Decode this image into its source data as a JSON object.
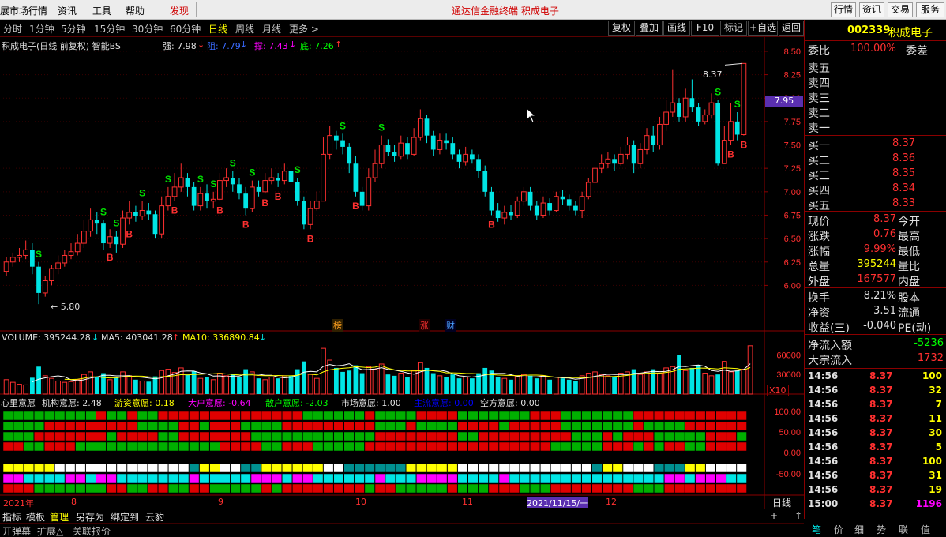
{
  "menu": {
    "items": [
      "展市场行情",
      "资讯",
      "工具",
      "帮助"
    ],
    "discover": "发现",
    "center_title": "通达信金融终端   积成电子",
    "right_buttons": [
      "行情",
      "资讯",
      "交易",
      "服务"
    ]
  },
  "toolbar": {
    "periods": [
      "分时",
      "1分钟",
      "5分钟",
      "15分钟",
      "30分钟",
      "60分钟",
      "日线",
      "周线",
      "月线",
      "更多 >"
    ],
    "active_period": "日线",
    "buttons": [
      "复权",
      "叠加",
      "画线",
      "F10",
      "标记",
      "+自选",
      "返回"
    ]
  },
  "chart_info": {
    "title": "积成电子(日线 前复权) 智能BS",
    "qiang": "强: 7.98",
    "zu": "阻: 7.79",
    "cheng": "撑: 7.43",
    "di": "底: 7.26",
    "current_price_tag": "7.95",
    "high_label": "8.37",
    "low_label": "5.80",
    "event_tags": [
      "榜",
      "涨",
      "财"
    ]
  },
  "volume_info": {
    "volume": "VOLUME: 395244.28",
    "ma5": "MA5: 403041.28",
    "ma10": "MA10: 336890.84",
    "x10": "X10"
  },
  "indicator_info": {
    "items": [
      {
        "label": "心里意愿",
        "color": "#e0e0e0"
      },
      {
        "label": "机构意愿: 2.48",
        "color": "#e0e0e0"
      },
      {
        "label": "游资意愿: 0.18",
        "color": "#ffff00"
      },
      {
        "label": "大户意愿: -0.64",
        "color": "#ff00ff"
      },
      {
        "label": "散户意愿: -2.03",
        "color": "#00ff00"
      },
      {
        "label": "市场意愿: 1.00",
        "color": "#e0e0e0"
      },
      {
        "label": "主流意愿: 0.00",
        "color": "#0000ff"
      },
      {
        "label": "空方意愿: 0.00",
        "color": "#e0e0e0"
      }
    ]
  },
  "date_axis": {
    "year": "2021年",
    "months": [
      "8",
      "9",
      "10",
      "11",
      "12"
    ],
    "cursor_date": "2021/11/15/一",
    "tab": "日线",
    "controls": [
      "+",
      "-",
      "↑"
    ]
  },
  "bottom_tabs": [
    "指标",
    "模板",
    "管理",
    "另存为",
    "绑定到",
    "云豹"
  ],
  "bottom_active": "管理",
  "bottom_bar": [
    "开弹幕",
    "扩展△",
    "关联报价"
  ],
  "right_panel": {
    "code": "002339",
    "name": "积成电子",
    "weibi_label": "委比",
    "weibi_value": "100.00%",
    "weicha_label": "委差",
    "sell": [
      "卖五",
      "卖四",
      "卖三",
      "卖二",
      "卖一"
    ],
    "buy": [
      {
        "label": "买一",
        "price": "8.37"
      },
      {
        "label": "买二",
        "price": "8.36"
      },
      {
        "label": "买三",
        "price": "8.35"
      },
      {
        "label": "买四",
        "price": "8.34"
      },
      {
        "label": "买五",
        "price": "8.33"
      }
    ],
    "stats": [
      {
        "l1": "现价",
        "v": "8.37",
        "c": "#ff3030",
        "l2": "今开"
      },
      {
        "l1": "涨跌",
        "v": "0.76",
        "c": "#ff3030",
        "l2": "最高"
      },
      {
        "l1": "涨幅",
        "v": "9.99%",
        "c": "#ff3030",
        "l2": "最低"
      },
      {
        "l1": "总量",
        "v": "395244",
        "c": "#ffff00",
        "l2": "量比"
      },
      {
        "l1": "外盘",
        "v": "167577",
        "c": "#ff3030",
        "l2": "内盘"
      }
    ],
    "stats2": [
      {
        "l1": "换手",
        "v": "8.21%",
        "c": "#e0e0e0",
        "l2": "股本"
      },
      {
        "l1": "净资",
        "v": "3.51",
        "c": "#e0e0e0",
        "l2": "流通"
      },
      {
        "l1": "收益(三)",
        "v": "-0.040",
        "c": "#e0e0e0",
        "l2": "PE(动)"
      }
    ],
    "net_inflow_label": "净流入额",
    "net_inflow_value": "-5236",
    "block_inflow_label": "大宗流入",
    "block_inflow_value": "1732",
    "ticks": [
      {
        "t": "14:56",
        "p": "8.37",
        "v": "100"
      },
      {
        "t": "14:56",
        "p": "8.37",
        "v": "32"
      },
      {
        "t": "14:56",
        "p": "8.37",
        "v": "7"
      },
      {
        "t": "14:56",
        "p": "8.37",
        "v": "11"
      },
      {
        "t": "14:56",
        "p": "8.37",
        "v": "30"
      },
      {
        "t": "14:56",
        "p": "8.37",
        "v": "5"
      },
      {
        "t": "14:56",
        "p": "8.37",
        "v": "100"
      },
      {
        "t": "14:56",
        "p": "8.37",
        "v": "31"
      },
      {
        "t": "14:56",
        "p": "8.37",
        "v": "19"
      },
      {
        "t": "15:00",
        "p": "8.37",
        "v": "1196"
      }
    ],
    "bottom_tabs": [
      "笔",
      "价",
      "细",
      "势",
      "联",
      "值"
    ]
  },
  "axis_labels": {
    "price": [
      "8.50",
      "8.25",
      "8.00",
      "7.75",
      "7.50",
      "7.25",
      "7.00",
      "6.75",
      "6.50",
      "6.25",
      "6.00"
    ],
    "volume": [
      "60000",
      "30000"
    ],
    "indicator": [
      "100.00",
      "50.00",
      "0.00",
      "-50.00"
    ]
  },
  "colors": {
    "up": "#ff3030",
    "down": "#00e5e5",
    "grid": "#8b0000",
    "accent_yellow": "#ffff00"
  },
  "chart_data": {
    "type": "candlestick",
    "y_range": [
      5.7,
      8.55
    ],
    "candles": [
      {
        "o": 6.15,
        "c": 6.25,
        "h": 6.3,
        "l": 6.1
      },
      {
        "o": 6.25,
        "c": 6.3,
        "h": 6.35,
        "l": 6.2
      },
      {
        "o": 6.3,
        "c": 6.32,
        "h": 6.4,
        "l": 6.25
      },
      {
        "o": 6.32,
        "c": 6.38,
        "h": 6.48,
        "l": 6.28
      },
      {
        "o": 6.38,
        "c": 6.2,
        "h": 6.45,
        "l": 6.12
      },
      {
        "o": 6.2,
        "c": 5.92,
        "h": 6.25,
        "l": 5.8
      },
      {
        "o": 5.92,
        "c": 6.05,
        "h": 6.1,
        "l": 5.88
      },
      {
        "o": 6.05,
        "c": 6.18,
        "h": 6.22,
        "l": 6.0
      },
      {
        "o": 6.18,
        "c": 6.24,
        "h": 6.32,
        "l": 6.12
      },
      {
        "o": 6.24,
        "c": 6.32,
        "h": 6.38,
        "l": 6.2
      },
      {
        "o": 6.32,
        "c": 6.36,
        "h": 6.45,
        "l": 6.28
      },
      {
        "o": 6.36,
        "c": 6.45,
        "h": 6.55,
        "l": 6.32
      },
      {
        "o": 6.45,
        "c": 6.58,
        "h": 6.7,
        "l": 6.4
      },
      {
        "o": 6.58,
        "c": 6.7,
        "h": 6.82,
        "l": 6.52
      },
      {
        "o": 6.7,
        "c": 6.66,
        "h": 6.78,
        "l": 6.55
      },
      {
        "o": 6.66,
        "c": 6.45,
        "h": 6.7,
        "l": 6.38
      },
      {
        "o": 6.45,
        "c": 6.52,
        "h": 6.6,
        "l": 6.4
      },
      {
        "o": 6.52,
        "c": 6.44,
        "h": 6.58,
        "l": 6.35
      },
      {
        "o": 6.44,
        "c": 6.72,
        "h": 6.8,
        "l": 6.4
      },
      {
        "o": 6.72,
        "c": 6.78,
        "h": 6.9,
        "l": 6.65
      },
      {
        "o": 6.78,
        "c": 6.74,
        "h": 6.85,
        "l": 6.68
      },
      {
        "o": 6.74,
        "c": 6.8,
        "h": 6.9,
        "l": 6.7
      },
      {
        "o": 6.8,
        "c": 6.76,
        "h": 6.88,
        "l": 6.7
      },
      {
        "o": 6.76,
        "c": 6.55,
        "h": 6.8,
        "l": 6.5
      },
      {
        "o": 6.55,
        "c": 6.85,
        "h": 6.95,
        "l": 6.5
      },
      {
        "o": 6.85,
        "c": 6.95,
        "h": 7.05,
        "l": 6.8
      },
      {
        "o": 6.95,
        "c": 7.05,
        "h": 7.2,
        "l": 6.9
      },
      {
        "o": 7.05,
        "c": 7.15,
        "h": 7.3,
        "l": 7.0
      },
      {
        "o": 7.15,
        "c": 7.05,
        "h": 7.2,
        "l": 6.95
      },
      {
        "o": 7.05,
        "c": 6.85,
        "h": 7.1,
        "l": 6.8
      },
      {
        "o": 6.85,
        "c": 6.98,
        "h": 7.05,
        "l": 6.8
      },
      {
        "o": 6.98,
        "c": 6.9,
        "h": 7.08,
        "l": 6.82
      },
      {
        "o": 6.9,
        "c": 6.92,
        "h": 7.0,
        "l": 6.82
      },
      {
        "o": 6.92,
        "c": 7.12,
        "h": 7.2,
        "l": 6.9
      },
      {
        "o": 7.12,
        "c": 7.15,
        "h": 7.25,
        "l": 7.05
      },
      {
        "o": 7.15,
        "c": 7.08,
        "h": 7.22,
        "l": 7.0
      },
      {
        "o": 7.08,
        "c": 6.98,
        "h": 7.15,
        "l": 6.92
      },
      {
        "o": 6.98,
        "c": 6.82,
        "h": 7.05,
        "l": 6.75
      },
      {
        "o": 6.82,
        "c": 7.05,
        "h": 7.12,
        "l": 6.78
      },
      {
        "o": 7.05,
        "c": 7.0,
        "h": 7.12,
        "l": 6.95
      },
      {
        "o": 7.0,
        "c": 7.12,
        "h": 7.2,
        "l": 6.98
      },
      {
        "o": 7.12,
        "c": 7.15,
        "h": 7.25,
        "l": 7.08
      },
      {
        "o": 7.15,
        "c": 7.12,
        "h": 7.2,
        "l": 7.05
      },
      {
        "o": 7.12,
        "c": 7.22,
        "h": 7.3,
        "l": 7.08
      },
      {
        "o": 7.22,
        "c": 7.1,
        "h": 7.28,
        "l": 7.02
      },
      {
        "o": 7.1,
        "c": 6.9,
        "h": 7.15,
        "l": 6.85
      },
      {
        "o": 6.9,
        "c": 6.65,
        "h": 6.95,
        "l": 6.6
      },
      {
        "o": 6.65,
        "c": 6.82,
        "h": 6.9,
        "l": 6.6
      },
      {
        "o": 6.82,
        "c": 6.9,
        "h": 7.0,
        "l": 6.8
      },
      {
        "o": 6.9,
        "c": 7.4,
        "h": 7.58,
        "l": 6.9
      },
      {
        "o": 7.4,
        "c": 7.6,
        "h": 7.7,
        "l": 7.35
      },
      {
        "o": 7.6,
        "c": 7.55,
        "h": 7.65,
        "l": 7.45
      },
      {
        "o": 7.55,
        "c": 7.48,
        "h": 7.62,
        "l": 7.4
      },
      {
        "o": 7.48,
        "c": 7.3,
        "h": 7.52,
        "l": 7.2
      },
      {
        "o": 7.3,
        "c": 7.0,
        "h": 7.38,
        "l": 6.95
      },
      {
        "o": 7.0,
        "c": 6.85,
        "h": 7.05,
        "l": 6.8
      },
      {
        "o": 6.85,
        "c": 7.15,
        "h": 7.25,
        "l": 6.8
      },
      {
        "o": 7.15,
        "c": 7.3,
        "h": 7.45,
        "l": 7.1
      },
      {
        "o": 7.3,
        "c": 7.5,
        "h": 7.6,
        "l": 7.25
      },
      {
        "o": 7.5,
        "c": 7.42,
        "h": 7.56,
        "l": 7.38
      },
      {
        "o": 7.42,
        "c": 7.38,
        "h": 7.5,
        "l": 7.32
      },
      {
        "o": 7.38,
        "c": 7.52,
        "h": 7.6,
        "l": 7.35
      },
      {
        "o": 7.52,
        "c": 7.4,
        "h": 7.58,
        "l": 7.35
      },
      {
        "o": 7.4,
        "c": 7.58,
        "h": 7.68,
        "l": 7.38
      },
      {
        "o": 7.58,
        "c": 7.78,
        "h": 7.88,
        "l": 7.55
      },
      {
        "o": 7.78,
        "c": 7.6,
        "h": 7.82,
        "l": 7.52
      },
      {
        "o": 7.6,
        "c": 7.45,
        "h": 7.65,
        "l": 7.38
      },
      {
        "o": 7.45,
        "c": 7.55,
        "h": 7.62,
        "l": 7.4
      },
      {
        "o": 7.55,
        "c": 7.52,
        "h": 7.62,
        "l": 7.45
      },
      {
        "o": 7.52,
        "c": 7.4,
        "h": 7.58,
        "l": 7.35
      },
      {
        "o": 7.4,
        "c": 7.32,
        "h": 7.45,
        "l": 7.25
      },
      {
        "o": 7.32,
        "c": 7.4,
        "h": 7.48,
        "l": 7.28
      },
      {
        "o": 7.4,
        "c": 7.35,
        "h": 7.45,
        "l": 7.3
      },
      {
        "o": 7.35,
        "c": 7.22,
        "h": 7.4,
        "l": 7.15
      },
      {
        "o": 7.22,
        "c": 7.0,
        "h": 7.28,
        "l": 6.95
      },
      {
        "o": 7.0,
        "c": 6.8,
        "h": 7.05,
        "l": 6.75
      },
      {
        "o": 6.8,
        "c": 6.72,
        "h": 6.88,
        "l": 6.68
      },
      {
        "o": 6.72,
        "c": 6.78,
        "h": 6.85,
        "l": 6.65
      },
      {
        "o": 6.78,
        "c": 6.75,
        "h": 6.86,
        "l": 6.7
      },
      {
        "o": 6.75,
        "c": 6.9,
        "h": 6.95,
        "l": 6.72
      },
      {
        "o": 6.9,
        "c": 7.0,
        "h": 7.05,
        "l": 6.85
      },
      {
        "o": 7.0,
        "c": 6.85,
        "h": 7.05,
        "l": 6.8
      },
      {
        "o": 6.85,
        "c": 6.75,
        "h": 6.9,
        "l": 6.7
      },
      {
        "o": 6.75,
        "c": 6.88,
        "h": 6.95,
        "l": 6.72
      },
      {
        "o": 6.88,
        "c": 6.8,
        "h": 6.93,
        "l": 6.75
      },
      {
        "o": 6.8,
        "c": 6.95,
        "h": 7.0,
        "l": 6.78
      },
      {
        "o": 6.95,
        "c": 6.92,
        "h": 7.02,
        "l": 6.86
      },
      {
        "o": 6.92,
        "c": 6.85,
        "h": 6.97,
        "l": 6.8
      },
      {
        "o": 6.85,
        "c": 6.8,
        "h": 6.9,
        "l": 6.75
      },
      {
        "o": 6.8,
        "c": 6.95,
        "h": 7.0,
        "l": 6.72
      },
      {
        "o": 6.95,
        "c": 7.1,
        "h": 7.15,
        "l": 6.92
      },
      {
        "o": 7.1,
        "c": 7.25,
        "h": 7.3,
        "l": 7.05
      },
      {
        "o": 7.25,
        "c": 7.3,
        "h": 7.4,
        "l": 7.2
      },
      {
        "o": 7.3,
        "c": 7.35,
        "h": 7.42,
        "l": 7.25
      },
      {
        "o": 7.35,
        "c": 7.3,
        "h": 7.4,
        "l": 7.22
      },
      {
        "o": 7.3,
        "c": 7.4,
        "h": 7.48,
        "l": 7.28
      },
      {
        "o": 7.4,
        "c": 7.5,
        "h": 7.58,
        "l": 7.35
      },
      {
        "o": 7.5,
        "c": 7.3,
        "h": 7.55,
        "l": 7.2
      },
      {
        "o": 7.3,
        "c": 7.45,
        "h": 7.52,
        "l": 7.25
      },
      {
        "o": 7.45,
        "c": 7.6,
        "h": 7.68,
        "l": 7.4
      },
      {
        "o": 7.6,
        "c": 7.5,
        "h": 7.7,
        "l": 7.42
      },
      {
        "o": 7.5,
        "c": 7.72,
        "h": 7.8,
        "l": 7.45
      },
      {
        "o": 7.72,
        "c": 7.85,
        "h": 7.98,
        "l": 7.65
      },
      {
        "o": 7.85,
        "c": 7.95,
        "h": 8.3,
        "l": 7.8
      },
      {
        "o": 7.95,
        "c": 7.8,
        "h": 8.0,
        "l": 7.75
      },
      {
        "o": 7.8,
        "c": 8.0,
        "h": 8.1,
        "l": 7.75
      },
      {
        "o": 8.0,
        "c": 7.9,
        "h": 8.2,
        "l": 7.85
      },
      {
        "o": 7.9,
        "c": 7.75,
        "h": 7.95,
        "l": 7.7
      },
      {
        "o": 7.75,
        "c": 7.82,
        "h": 7.88,
        "l": 7.72
      },
      {
        "o": 7.82,
        "c": 7.95,
        "h": 8.05,
        "l": 7.78
      },
      {
        "o": 7.95,
        "c": 7.3,
        "h": 7.98,
        "l": 7.28
      },
      {
        "o": 7.3,
        "c": 7.55,
        "h": 7.7,
        "l": 7.3
      },
      {
        "o": 7.55,
        "c": 7.75,
        "h": 7.95,
        "l": 7.5
      },
      {
        "o": 7.75,
        "c": 7.61,
        "h": 7.85,
        "l": 7.55
      },
      {
        "o": 7.61,
        "c": 8.37,
        "h": 8.37,
        "l": 7.6
      }
    ],
    "signals": [
      {
        "i": 5,
        "t": "S"
      },
      {
        "i": 15,
        "t": "S"
      },
      {
        "i": 16,
        "t": "B"
      },
      {
        "i": 17,
        "t": "S"
      },
      {
        "i": 19,
        "t": "B"
      },
      {
        "i": 21,
        "t": "S"
      },
      {
        "i": 25,
        "t": "S"
      },
      {
        "i": 26,
        "t": "B"
      },
      {
        "i": 30,
        "t": "S"
      },
      {
        "i": 32,
        "t": "S"
      },
      {
        "i": 33,
        "t": "B"
      },
      {
        "i": 35,
        "t": "S"
      },
      {
        "i": 37,
        "t": "B"
      },
      {
        "i": 38,
        "t": "S"
      },
      {
        "i": 40,
        "t": "B"
      },
      {
        "i": 42,
        "t": "B"
      },
      {
        "i": 45,
        "t": "S"
      },
      {
        "i": 47,
        "t": "B"
      },
      {
        "i": 52,
        "t": "S"
      },
      {
        "i": 54,
        "t": "B"
      },
      {
        "i": 58,
        "t": "S"
      },
      {
        "i": 75,
        "t": "B"
      },
      {
        "i": 110,
        "t": "S"
      },
      {
        "i": 112,
        "t": "B"
      },
      {
        "i": 113,
        "t": "S"
      },
      {
        "i": 114,
        "t": "B"
      }
    ],
    "volume": [
      22000,
      18000,
      15000,
      14000,
      25000,
      42000,
      28000,
      24000,
      20000,
      18000,
      19000,
      22000,
      30000,
      34000,
      26000,
      32000,
      22000,
      25000,
      34000,
      28000,
      22000,
      20000,
      19000,
      27000,
      36000,
      38000,
      33000,
      40000,
      30000,
      35000,
      24000,
      26000,
      22000,
      32000,
      28000,
      30000,
      26000,
      38000,
      34000,
      24000,
      22000,
      26000,
      24000,
      28000,
      28000,
      38000,
      50000,
      30000,
      24000,
      70000,
      52000,
      40000,
      34000,
      36000,
      44000,
      32000,
      42000,
      38000,
      46000,
      30000,
      28000,
      32000,
      26000,
      36000,
      48000,
      40000,
      32000,
      28000,
      26000,
      30000,
      24000,
      26000,
      24000,
      32000,
      40000,
      36000,
      26000,
      24000,
      22000,
      28000,
      30000,
      28000,
      24000,
      28000,
      22000,
      26000,
      24000,
      22000,
      20000,
      28000,
      32000,
      34000,
      30000,
      28000,
      26000,
      32000,
      34000,
      38000,
      30000,
      34000,
      38000,
      32000,
      40000,
      42000,
      60000,
      36000,
      40000,
      44000,
      32000,
      28000,
      30000,
      50000,
      34000,
      36000,
      38000,
      74000
    ],
    "volume_range": [
      0,
      75000
    ]
  }
}
